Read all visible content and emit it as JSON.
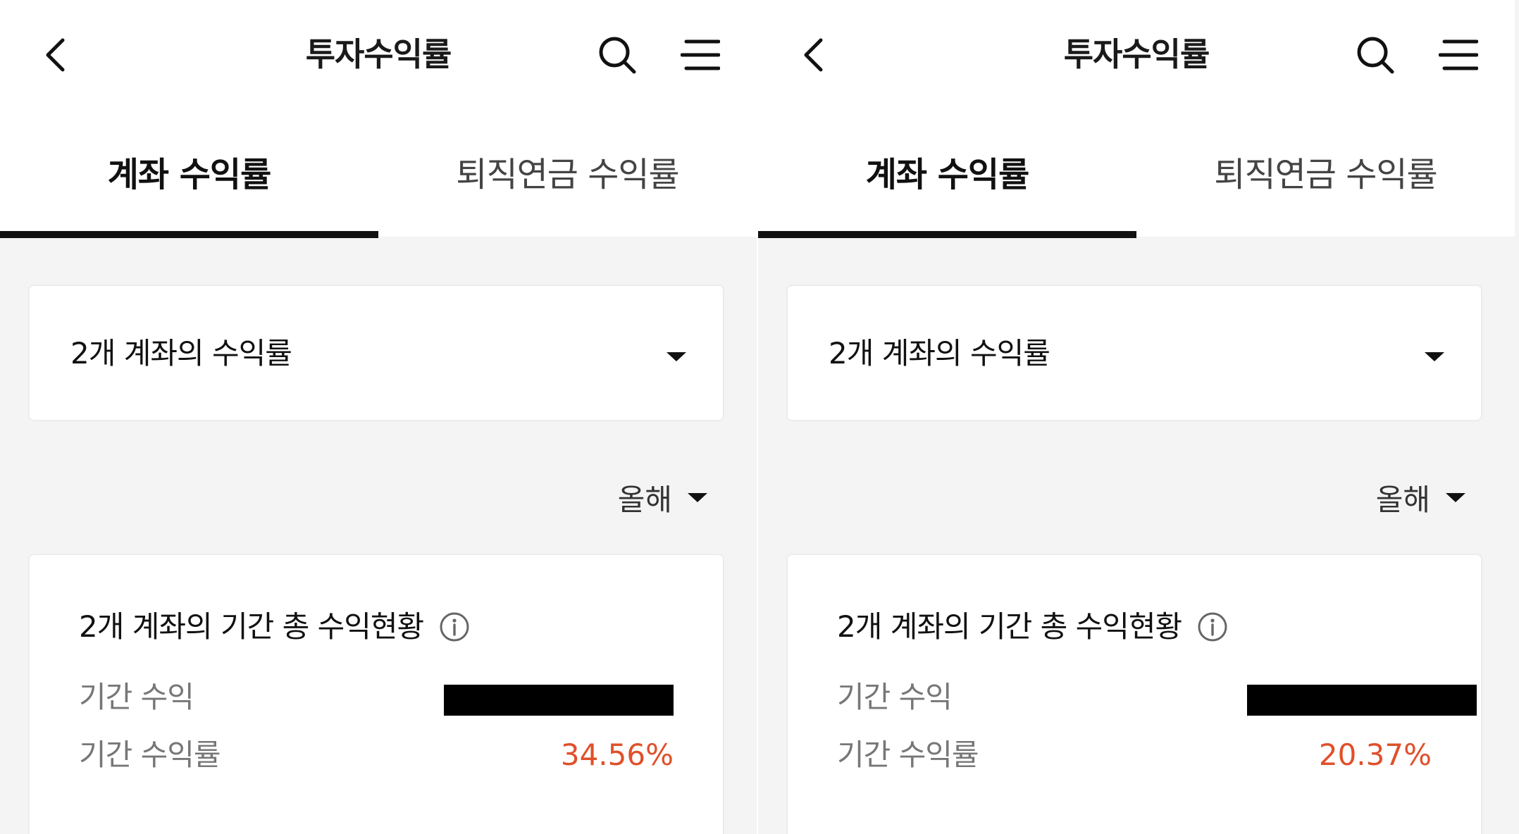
{
  "panels": [
    {
      "header": {
        "title": "투자수익률"
      },
      "tabs": [
        {
          "label": "계좌 수익률",
          "active": true
        },
        {
          "label": "퇴직연금 수익률",
          "active": false
        }
      ],
      "account_select": {
        "label": "2개 계좌의 수익률"
      },
      "period_select": {
        "label": "올해"
      },
      "summary": {
        "title": "2개 계좌의 기간 총 수익현황",
        "profit_label": "기간 수익",
        "rate_label": "기간 수익률",
        "rate_value": "34.56%"
      }
    },
    {
      "header": {
        "title": "투자수익률"
      },
      "tabs": [
        {
          "label": "계좌 수익률",
          "active": true
        },
        {
          "label": "퇴직연금 수익률",
          "active": false
        }
      ],
      "account_select": {
        "label": "2개 계좌의 수익률"
      },
      "period_select": {
        "label": "올해"
      },
      "summary": {
        "title": "2개 계좌의 기간 총 수익현황",
        "profit_label": "기간 수익",
        "rate_label": "기간 수익률",
        "rate_value": "20.37%"
      }
    }
  ],
  "icons": {
    "back": "chevron-left-icon",
    "search": "search-icon",
    "menu": "hamburger-menu-icon",
    "dropdown": "caret-down-icon",
    "info": "info-circle-icon"
  },
  "colors": {
    "accent_rate": "#e0502a",
    "active_tab_indicator": "#111111",
    "background": "#f4f4f4",
    "card": "#ffffff"
  }
}
